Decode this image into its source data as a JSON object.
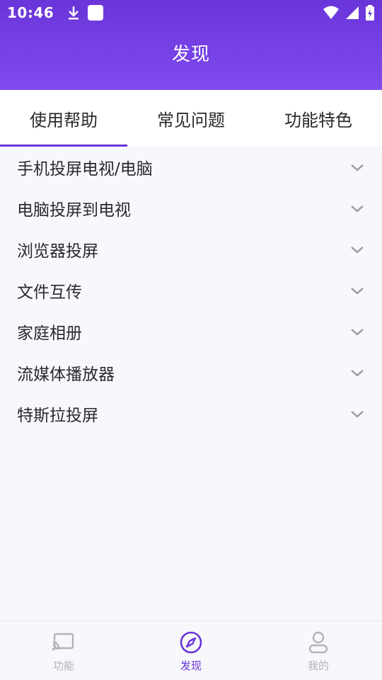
{
  "status_bar": {
    "time": "10:46",
    "icons": [
      "download-icon",
      "app-square-icon",
      "wifi-icon",
      "signal-icon",
      "battery-icon"
    ]
  },
  "header": {
    "title": "发现"
  },
  "tabs": [
    {
      "label": "使用帮助",
      "active": true
    },
    {
      "label": "常见问题",
      "active": false
    },
    {
      "label": "功能特色",
      "active": false
    }
  ],
  "help_items": [
    {
      "label": "手机投屏电视/电脑"
    },
    {
      "label": "电脑投屏到电视"
    },
    {
      "label": "浏览器投屏"
    },
    {
      "label": "文件互传"
    },
    {
      "label": "家庭相册"
    },
    {
      "label": "流媒体播放器"
    },
    {
      "label": "特斯拉投屏"
    }
  ],
  "bottom_nav": [
    {
      "label": "功能",
      "icon": "cast-icon",
      "active": false
    },
    {
      "label": "发现",
      "icon": "compass-icon",
      "active": true
    },
    {
      "label": "我的",
      "icon": "person-icon",
      "active": false
    }
  ],
  "colors": {
    "accent": "#6a35d8",
    "header_gradient_top": "#6a35d8",
    "header_gradient_bottom": "#7f4af0",
    "inactive_nav": "#b2b2b8",
    "background": "#f7f8fb"
  }
}
